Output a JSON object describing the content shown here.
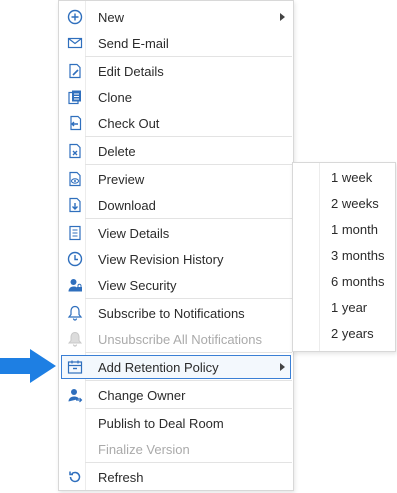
{
  "menu": {
    "items": [
      {
        "label": "New",
        "icon": "plus-circle-icon",
        "submenu": true
      },
      {
        "label": "Send E-mail",
        "icon": "envelope-icon"
      },
      {
        "label": "Edit Details",
        "icon": "edit-document-icon"
      },
      {
        "label": "Clone",
        "icon": "clone-document-icon"
      },
      {
        "label": "Check Out",
        "icon": "check-out-icon"
      },
      {
        "label": "Delete",
        "icon": "delete-document-icon"
      },
      {
        "label": "Preview",
        "icon": "preview-eye-icon"
      },
      {
        "label": "Download",
        "icon": "download-icon"
      },
      {
        "label": "View Details",
        "icon": "details-list-icon"
      },
      {
        "label": "View Revision History",
        "icon": "clock-history-icon"
      },
      {
        "label": "View Security",
        "icon": "user-lock-icon"
      },
      {
        "label": "Subscribe to Notifications",
        "icon": "bell-icon"
      },
      {
        "label": "Unsubscribe All Notifications",
        "icon": "bell-disabled-icon",
        "disabled": true
      },
      {
        "label": "Add Retention Policy",
        "icon": "retention-calendar-icon",
        "submenu": true,
        "highlighted": true
      },
      {
        "label": "Change Owner",
        "icon": "change-owner-icon"
      },
      {
        "label": "Publish to Deal Room"
      },
      {
        "label": "Finalize Version",
        "disabled": true
      },
      {
        "label": "Refresh",
        "icon": "refresh-icon"
      }
    ]
  },
  "submenu": {
    "options": [
      "1 week",
      "2 weeks",
      "1 month",
      "3 months",
      "6 months",
      "1 year",
      "2 years"
    ]
  },
  "colors": {
    "icon": "#2f6fbd",
    "pointer": "#1e7fe3",
    "highlight_border": "#3a7fd5",
    "disabled": "#aaaaaa"
  }
}
